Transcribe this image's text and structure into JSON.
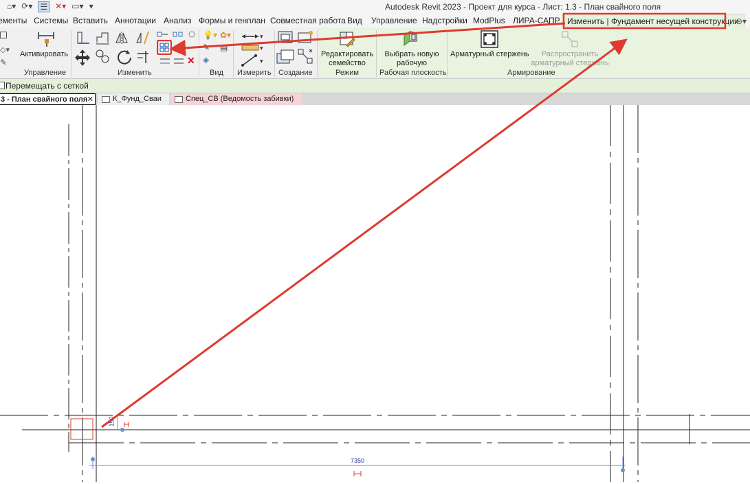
{
  "window": {
    "title": "Autodesk Revit 2023 - Проект для курса - Лист: 1.3 - План свайного поля"
  },
  "tabs": [
    {
      "label": "ементы"
    },
    {
      "label": "Системы"
    },
    {
      "label": "Вставить"
    },
    {
      "label": "Аннотации"
    },
    {
      "label": "Анализ"
    },
    {
      "label": "Формы и генплан"
    },
    {
      "label": "Совместная работа"
    },
    {
      "label": "Вид"
    },
    {
      "label": "Управление"
    },
    {
      "label": "Надстройки"
    },
    {
      "label": "ModPlus"
    },
    {
      "label": "ЛИРА-САПР"
    },
    {
      "label": "Изменить | Фундамент несущей конструкции"
    }
  ],
  "ribbon": {
    "activate_label": "Активировать",
    "panels": {
      "control": "Управление",
      "modify": "Изменить",
      "view": "Вид",
      "measure": "Измерить",
      "create": "Создание",
      "mode": "Режим",
      "work_plane": "Рабочая плоскость",
      "reinforcement": "Армирование"
    },
    "edit_family": "Редактировать семейство",
    "pick_work_plane": "Выбрать новую рабочую плоскость",
    "rebar": "Арматурный стержень",
    "distribute_rebar": "Распространить арматурный стержень"
  },
  "options_bar": {
    "move_with_grid": "Перемещать с сеткой"
  },
  "view_tabs": [
    {
      "label": "3 - План свайного поля"
    },
    {
      "label": "К_Фунд_Сваи"
    },
    {
      "label": "Спец_СВ (Ведомость забивки)"
    }
  ],
  "drawing": {
    "dimension_main": "7350",
    "dimension_small": "150"
  },
  "colors": {
    "annotation_red": "#e03a2f",
    "context_tab": "#e6f2dc",
    "dimension_blue": "#2a3f8a"
  }
}
